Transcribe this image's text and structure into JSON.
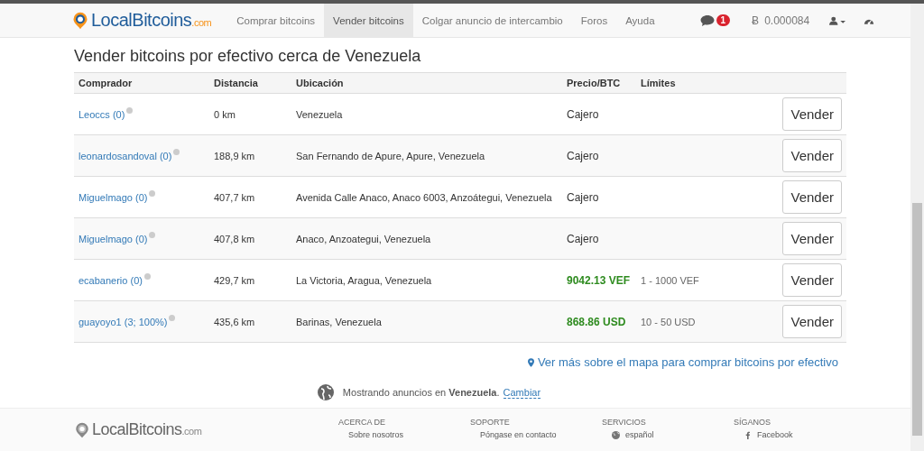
{
  "navbar": {
    "logo": {
      "name": "LocalBitcoins",
      "suffix": ".com"
    },
    "links": [
      {
        "label": "Comprar bitcoins",
        "selected": false
      },
      {
        "label": "Vender bitcoins",
        "selected": true
      },
      {
        "label": "Colgar anuncio de intercambio",
        "selected": false
      },
      {
        "label": "Foros",
        "selected": false
      },
      {
        "label": "Ayuda",
        "selected": false
      }
    ],
    "messages_badge": "1",
    "balance_symbol": "Ƀ",
    "balance": "0.000084"
  },
  "page_title": "Vender bitcoins por efectivo cerca de Venezuela",
  "table": {
    "columns": [
      "Comprador",
      "Distancia",
      "Ubicación",
      "Precio/BTC",
      "Límites"
    ],
    "rows": [
      {
        "buyer": "Leoccs (0)",
        "distance": "0 km",
        "location": "Venezuela",
        "price": "Cajero",
        "kind": "cash",
        "action": "Vender"
      },
      {
        "buyer": "leonardosandoval (0)",
        "distance": "188,9 km",
        "location": "San Fernando de Apure, Apure, Venezuela",
        "price": "Cajero",
        "kind": "cash",
        "action": "Vender"
      },
      {
        "buyer": "Miguelmago (0)",
        "distance": "407,7 km",
        "location": "Avenida Calle Anaco, Anaco 6003, Anzoátegui, Venezuela",
        "price": "Cajero",
        "kind": "cash",
        "action": "Vender"
      },
      {
        "buyer": "Miguelmago (0)",
        "distance": "407,8 km",
        "location": "Anaco, Anzoategui, Venezuela",
        "price": "Cajero",
        "kind": "cash",
        "action": "Vender"
      },
      {
        "buyer": "ecabanerio (0)",
        "distance": "429,7 km",
        "location": "La Victoria, Aragua, Venezuela",
        "price": "9042.13 VEF",
        "kind": "amount",
        "limits": "1 - 1000 VEF",
        "action": "Vender"
      },
      {
        "buyer": "guayoyo1 (3; 100%)",
        "distance": "435,6 km",
        "location": "Barinas, Venezuela",
        "price": "868.86 USD",
        "kind": "amount",
        "limits": "10 - 50 USD",
        "action": "Vender"
      }
    ]
  },
  "map_link": "Ver más sobre el mapa para comprar bitcoins por efectivo",
  "location_note": {
    "text": "Mostrando anuncios en **Venezuela**.",
    "link": "Cambiar"
  },
  "footer": {
    "logo": {
      "name": "LocalBitcoins",
      "suffix": ".com"
    },
    "columns": [
      {
        "heading": "ACERCA DE",
        "item": "Sobre nosotros",
        "kind": "plain"
      },
      {
        "heading": "SOPORTE",
        "item": "Póngase en contacto",
        "kind": "plain"
      },
      {
        "heading": "SERVICIOS",
        "item": "español",
        "kind": "language"
      },
      {
        "heading": "SÍGANOS",
        "item": "Facebook",
        "kind": "social"
      }
    ]
  }
}
